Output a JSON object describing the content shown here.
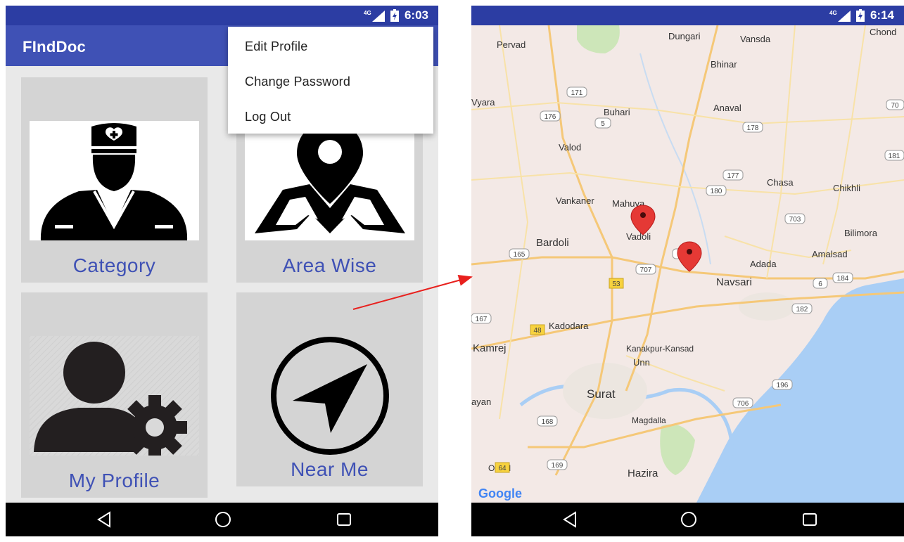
{
  "left_screen": {
    "status_time": "6:03",
    "network": "4G",
    "app_title": "FIndDoc",
    "menu": {
      "items": [
        "Edit Profile",
        "Change Password",
        "Log Out"
      ]
    },
    "tiles": [
      {
        "label": "Category",
        "icon": "doctor-icon"
      },
      {
        "label": "Area Wise",
        "icon": "map-pin-icon"
      },
      {
        "label": "My Profile",
        "icon": "user-settings-icon"
      },
      {
        "label": "Near Me",
        "icon": "navigation-compass-icon"
      }
    ]
  },
  "right_screen": {
    "status_time": "6:14",
    "network": "4G",
    "map": {
      "provider_logo": "Google",
      "places": [
        "Pervad",
        "Dungari",
        "Vansda",
        "Chond",
        "Bhinar",
        "Vyara",
        "Buhari",
        "Anaval",
        "Valod",
        "Chasa",
        "Chikhli",
        "Vankaner",
        "Mahuva",
        "Vadoli",
        "Bardoli",
        "Bilimora",
        "Amalsad",
        "Adada",
        "Navsari",
        "Kadodara",
        "Kamrej",
        "Kanakpur-Kansad",
        "Unn",
        "Surat",
        "ayan",
        "Magdalla",
        "Olpad",
        "Hazira"
      ],
      "road_shields": [
        "171",
        "176",
        "5",
        "178",
        "70",
        "181",
        "177",
        "180",
        "703",
        "165",
        "8",
        "707",
        "53",
        "6",
        "184",
        "182",
        "167",
        "48",
        "196",
        "706",
        "168",
        "169",
        "64"
      ]
    }
  },
  "colors": {
    "primary": "#3f51b5",
    "status_bar": "#2c3da3",
    "tile_bg": "#d4d4d4",
    "marker": "#e53935",
    "water": "#a9cef5",
    "arrow": "#e8201d"
  }
}
